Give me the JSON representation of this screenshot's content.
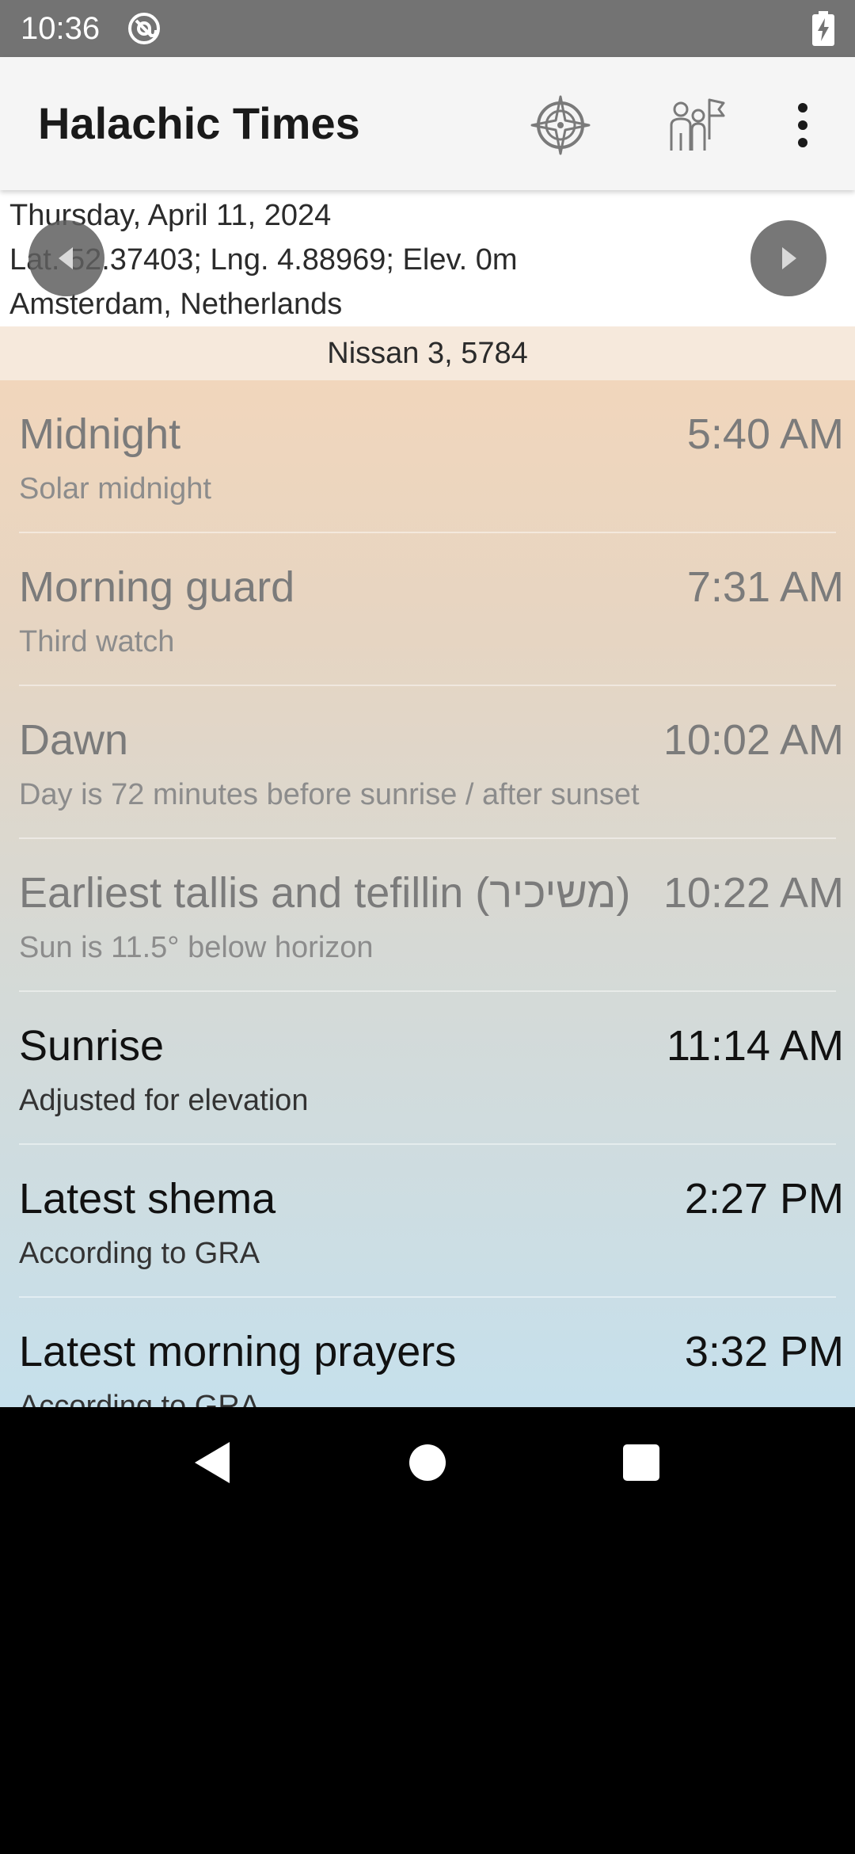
{
  "status_bar": {
    "time": "10:36",
    "icons": [
      "at-sign-icon",
      "battery-charging-icon"
    ]
  },
  "app_bar": {
    "title": "Halachic Times",
    "actions": [
      "compass-icon",
      "people-flag-icon",
      "more-vert-icon"
    ]
  },
  "location": {
    "date": "Thursday, April 11, 2024",
    "coordinates": "Lat. 52.37403; Lng. 4.88969; Elev. 0m",
    "place": "Amsterdam, Netherlands",
    "prev_icon": "chevron-left-icon",
    "next_icon": "chevron-right-icon"
  },
  "hebrew_date": "Nissan 3, 5784",
  "times": [
    {
      "title": "Midnight",
      "time": "5:40 AM",
      "subtitle": "Solar midnight",
      "state": "past"
    },
    {
      "title": "Morning guard",
      "time": "7:31 AM",
      "subtitle": "Third watch",
      "state": "past"
    },
    {
      "title": "Dawn",
      "time": "10:02 AM",
      "subtitle": "Day is 72 minutes before sunrise / after sunset",
      "state": "past"
    },
    {
      "title": "Earliest tallis and tefillin (משיכיר)",
      "time": "10:22 AM",
      "subtitle": "Sun is 11.5° below horizon",
      "state": "past"
    },
    {
      "title": "Sunrise",
      "time": "11:14 AM",
      "subtitle": "Adjusted for elevation",
      "state": "current"
    },
    {
      "title": "Latest shema",
      "time": "2:27 PM",
      "subtitle": "According to GRA",
      "state": "current"
    },
    {
      "title": "Latest morning prayers",
      "time": "3:32 PM",
      "subtitle": "According to GRA",
      "state": "current"
    }
  ],
  "colors": {
    "past_text": "#7b7b7b",
    "current_text": "#111111",
    "hebrew_date_bg": "#f6e9dc",
    "list_gradient_top": "#f1d6bc",
    "list_gradient_bottom": "#c6e0ec"
  },
  "system_nav": [
    "back-icon",
    "home-icon",
    "recents-icon"
  ]
}
